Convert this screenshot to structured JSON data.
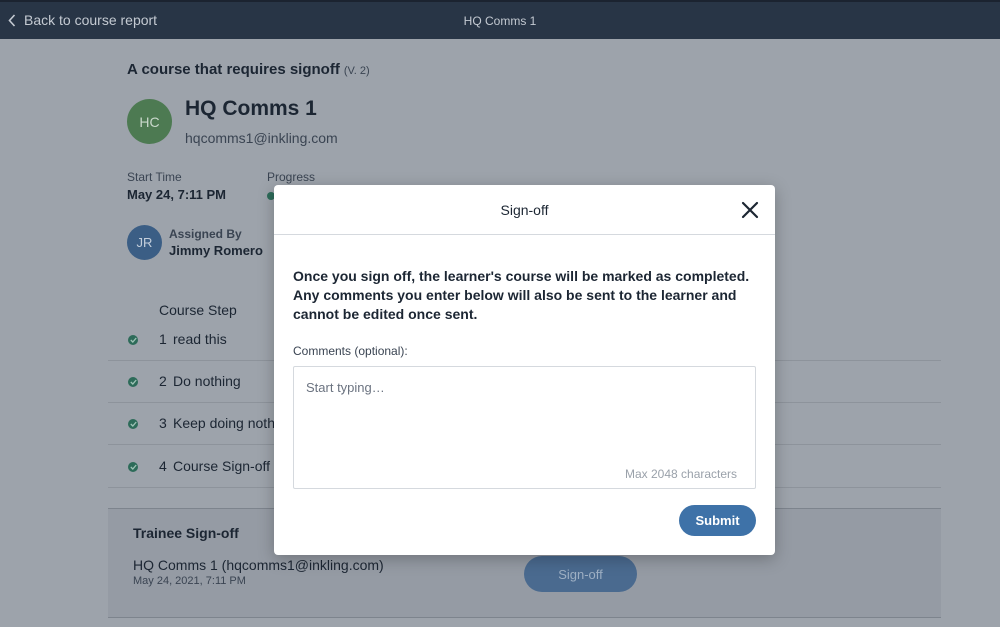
{
  "topbar": {
    "back_label": "Back to course report",
    "title": "HQ Comms 1"
  },
  "course": {
    "title": "A course that requires signoff",
    "version": "(V. 2)"
  },
  "learner": {
    "initials": "HC",
    "name": "HQ Comms 1",
    "email": "hqcomms1@inkling.com",
    "avatar_color": "#4d7a52"
  },
  "details": {
    "start_time_label": "Start Time",
    "start_time_value": "May 24, 7:11 PM",
    "progress_label": "Progress",
    "assigned_by_label": "Assigned By",
    "assigned_by_initials": "JR",
    "assigned_by_name": "Jimmy Romero"
  },
  "steps": {
    "header": "Course Step",
    "items": [
      {
        "num": "1",
        "label": "read this",
        "icon": "check-circle-icon"
      },
      {
        "num": "2",
        "label": "Do nothing",
        "icon": "check-circle-icon"
      },
      {
        "num": "3",
        "label": "Keep doing noth",
        "icon": "check-circle-icon"
      },
      {
        "num": "4",
        "label": "Course Sign-off",
        "icon": "check-circle-icon"
      }
    ]
  },
  "trainee_signoff": {
    "title": "Trainee Sign-off",
    "name": "HQ Comms 1 (hqcomms1@inkling.com)",
    "date": "May 24, 2021, 7:11 PM",
    "button_label": "Sign-off"
  },
  "modal": {
    "title": "Sign-off",
    "message": "Once you sign off, the learner's course will be marked as completed. Any comments you enter below will also be sent to the learner and cannot be edited once sent.",
    "comments_label": "Comments (optional):",
    "comments_placeholder": "Start typing…",
    "comments_value": "",
    "max_chars": "Max 2048 characters",
    "submit_label": "Submit"
  },
  "colors": {
    "topbar": "#283546",
    "overlay_bg": "#9da3ab",
    "accent": "#3e72a8",
    "success": "#2d6b59"
  }
}
